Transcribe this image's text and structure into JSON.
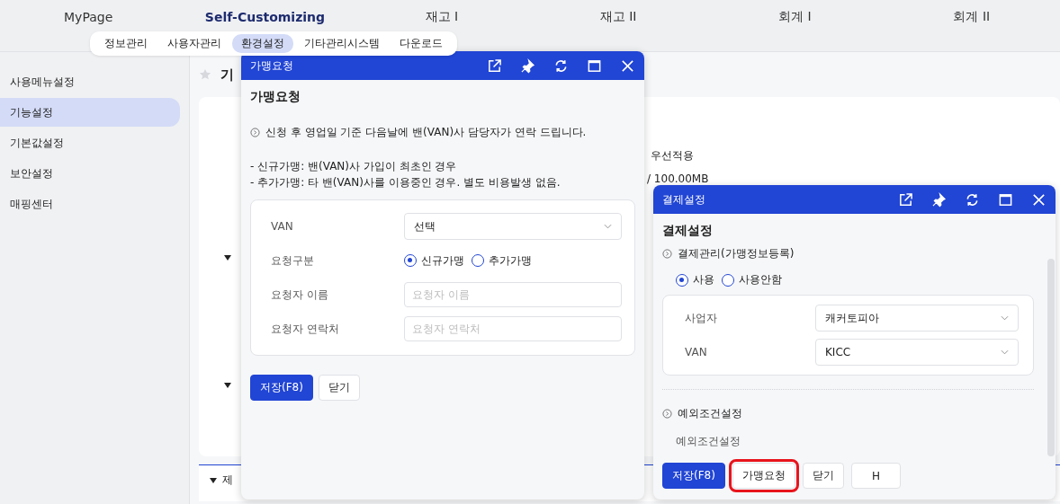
{
  "top_menu": [
    {
      "label": "MyPage",
      "selected": false
    },
    {
      "label": "Self-Customizing",
      "selected": true
    },
    {
      "label": "재고 I",
      "selected": false
    },
    {
      "label": "재고 II",
      "selected": false
    },
    {
      "label": "회계 I",
      "selected": false
    },
    {
      "label": "회계 II",
      "selected": false
    }
  ],
  "sub_menu": [
    {
      "label": "정보관리",
      "selected": false
    },
    {
      "label": "사용자관리",
      "selected": false
    },
    {
      "label": "환경설정",
      "selected": true
    },
    {
      "label": "기타관리시스템",
      "selected": false
    },
    {
      "label": "다운로드",
      "selected": false
    }
  ],
  "sidebar": {
    "items": [
      {
        "label": "사용메뉴설정",
        "selected": false
      },
      {
        "label": "기능설정",
        "selected": true
      },
      {
        "label": "기본값설정",
        "selected": false
      },
      {
        "label": "보안설정",
        "selected": false
      },
      {
        "label": "매핑센터",
        "selected": false
      }
    ]
  },
  "page": {
    "title": "기",
    "favorite": false,
    "fragments": [
      "우선적용",
      "/ 100.00MB"
    ],
    "bottom_section": "제"
  },
  "windows": [
    {
      "title": "가맹요청",
      "heading": "가맹요청",
      "info": "신청 후 영업일 기준 다음날에 밴(VAN)사 담당자가 연락 드립니다.",
      "notes": [
        "- 신규가맹: 밴(VAN)사 가입이 최초인 경우",
        "- 추가가맹: 타 밴(VAN)사를 이용중인 경우. 별도 비용발생 없음."
      ],
      "fields": [
        {
          "kind": "select",
          "label": "VAN",
          "value": "선택"
        },
        {
          "kind": "radio",
          "label": "요청구분",
          "options": [
            {
              "label": "신규가맹",
              "selected": true
            },
            {
              "label": "추가가맹",
              "selected": false
            }
          ]
        },
        {
          "kind": "input",
          "label": "요청자 이름",
          "placeholder": "요청자 이름"
        },
        {
          "kind": "input",
          "label": "요청자 연락처",
          "placeholder": "요청자 연락처"
        }
      ],
      "buttons": [
        {
          "label": "저장(F8)",
          "kind": "primary",
          "highlighted": false
        },
        {
          "label": "닫기",
          "kind": "default",
          "highlighted": false
        }
      ]
    },
    {
      "title": "결제설정",
      "heading": "결제설정",
      "section": "결제관리(가맹정보등록)",
      "usage": [
        {
          "label": "사용",
          "selected": true
        },
        {
          "label": "사용안함",
          "selected": false
        }
      ],
      "fields": [
        {
          "kind": "select",
          "label": "사업자",
          "value": "캐커토피아"
        },
        {
          "kind": "select",
          "label": "VAN",
          "value": "KICC"
        }
      ],
      "section2": "예외조건설정",
      "section2_text": "예외조건설정",
      "buttons": [
        {
          "label": "저장(F8)",
          "kind": "primary",
          "highlighted": false
        },
        {
          "label": "가맹요청",
          "kind": "default",
          "highlighted": true
        },
        {
          "label": "닫기",
          "kind": "default",
          "highlighted": false
        },
        {
          "label": "H",
          "kind": "default",
          "highlighted": false
        }
      ]
    }
  ]
}
